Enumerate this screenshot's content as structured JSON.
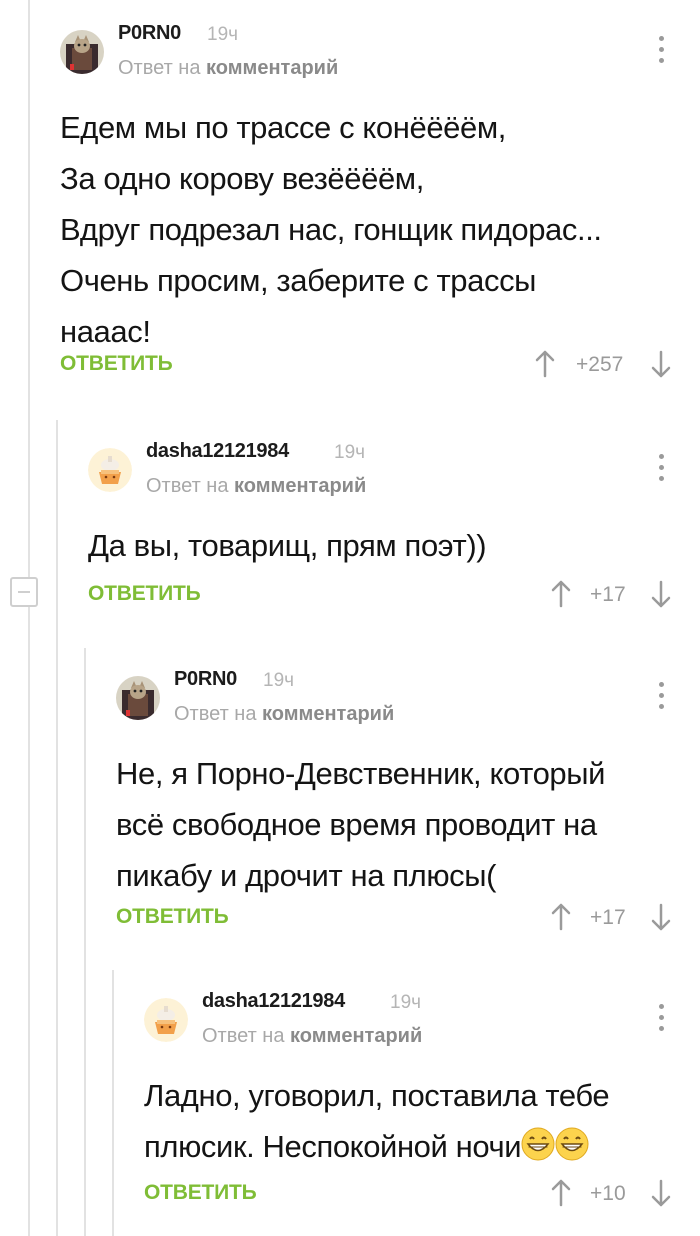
{
  "comments": [
    {
      "username": "P0RN0",
      "time": "19ч",
      "reply_prefix": "Ответ на",
      "reply_target": "комментарий",
      "lines": [
        "Едем мы по трассе с конёёёём,",
        "За одно корову везёёёём,",
        "Вдруг подрезал нас, гонщик пидорас...",
        "Очень просим, заберите с трассы",
        "нааас!"
      ],
      "reply_label": "ОТВЕТИТЬ",
      "score": "+257",
      "avatar": "cat-avatar"
    },
    {
      "username": "dasha12121984",
      "time": "19ч",
      "reply_prefix": "Ответ на",
      "reply_target": "комментарий",
      "lines": [
        "Да вы, товарищ, прям поэт))"
      ],
      "reply_label": "ОТВЕТИТЬ",
      "score": "+17",
      "avatar": "cupcake-avatar"
    },
    {
      "username": "P0RN0",
      "time": "19ч",
      "reply_prefix": "Ответ на",
      "reply_target": "комментарий",
      "lines": [
        "Не, я Порно-Девственник, который",
        "всё свободное время проводит на",
        "пикабу и дрочит на плюсы("
      ],
      "reply_label": "ОТВЕТИТЬ",
      "score": "+17",
      "avatar": "cat-avatar"
    },
    {
      "username": "dasha12121984",
      "time": "19ч",
      "reply_prefix": "Ответ на",
      "reply_target": "комментарий",
      "lines": [
        "Ладно, уговорил, поставила тебе",
        "плюсик. Неспокойной ночи"
      ],
      "emoji": "grinning-face-icon",
      "reply_label": "ОТВЕТИТЬ",
      "score": "+10",
      "avatar": "cupcake-avatar"
    }
  ],
  "colors": {
    "accent": "#7fbd36",
    "muted": "#a8a8a8",
    "line": "#e2e2e2"
  }
}
